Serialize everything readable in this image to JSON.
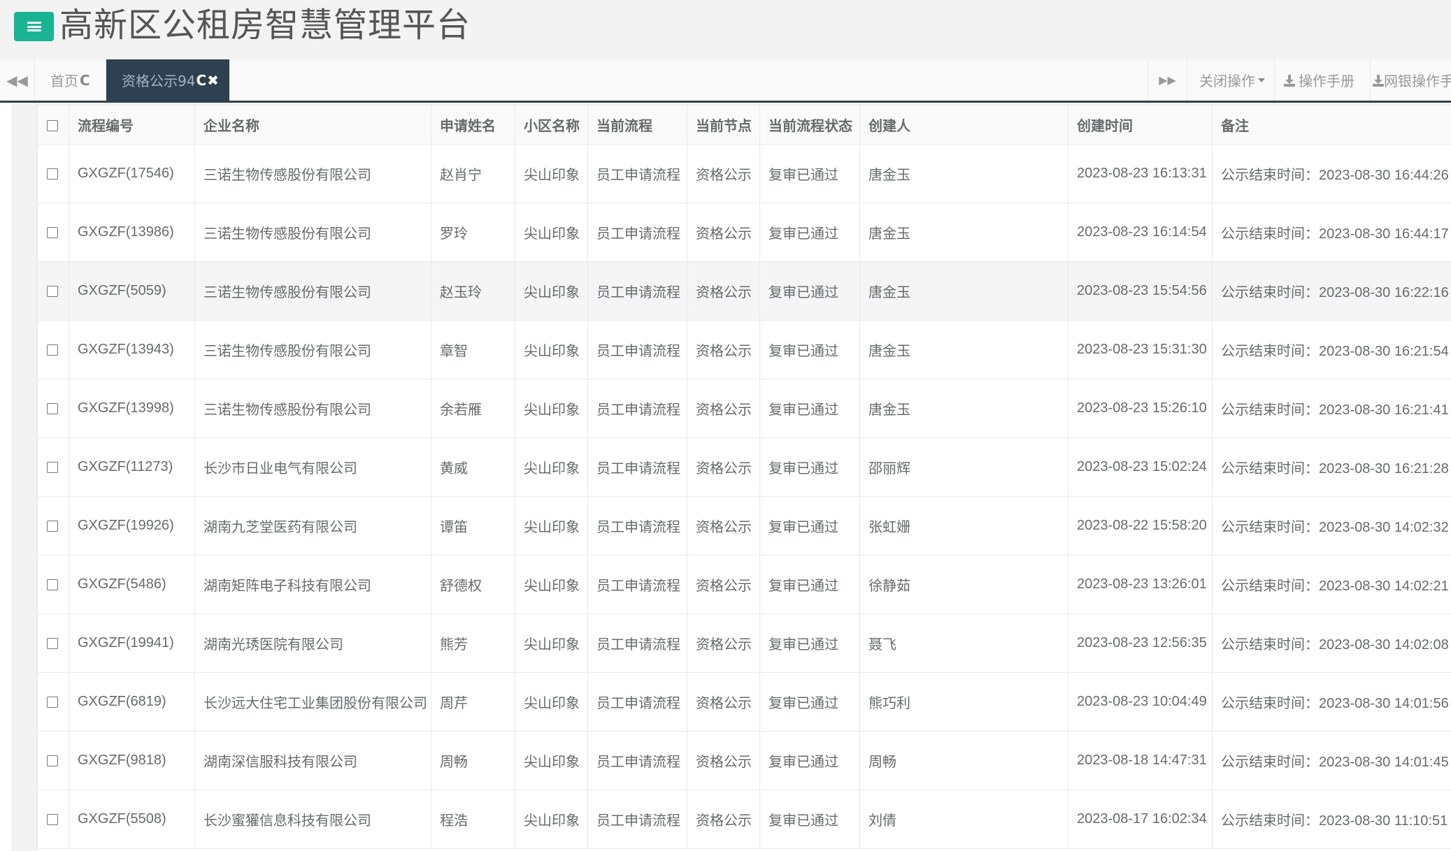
{
  "header": {
    "title": "高新区公租房智慧管理平台",
    "menu_icon": "hamburger-icon",
    "accent_color": "#1ab394"
  },
  "tabs": {
    "home": {
      "label": "首页",
      "icon": "reload-icon"
    },
    "active": {
      "label": "资格公示94",
      "icons": [
        "reload-icon",
        "close-icon"
      ]
    },
    "close_ops": "关闭操作",
    "manual": "操作手册",
    "ebank_manual": "网银操作手册"
  },
  "table": {
    "headers": [
      "流程编号",
      "企业名称",
      "申请姓名",
      "小区名称",
      "当前流程",
      "当前节点",
      "当前流程状态",
      "创建人",
      "创建时间",
      "备注"
    ],
    "rows": [
      [
        "GXGZF(17546)",
        "三诺生物传感股份有限公司",
        "赵肖宁",
        "尖山印象",
        "员工申请流程",
        "资格公示",
        "复审已通过",
        "唐金玉",
        "2023-08-23 16:13:31",
        "公示结束时间：2023-08-30 16:44:26"
      ],
      [
        "GXGZF(13986)",
        "三诺生物传感股份有限公司",
        "罗玲",
        "尖山印象",
        "员工申请流程",
        "资格公示",
        "复审已通过",
        "唐金玉",
        "2023-08-23 16:14:54",
        "公示结束时间：2023-08-30 16:44:17"
      ],
      [
        "GXGZF(5059)",
        "三诺生物传感股份有限公司",
        "赵玉玲",
        "尖山印象",
        "员工申请流程",
        "资格公示",
        "复审已通过",
        "唐金玉",
        "2023-08-23 15:54:56",
        "公示结束时间：2023-08-30 16:22:16"
      ],
      [
        "GXGZF(13943)",
        "三诺生物传感股份有限公司",
        "章智",
        "尖山印象",
        "员工申请流程",
        "资格公示",
        "复审已通过",
        "唐金玉",
        "2023-08-23 15:31:30",
        "公示结束时间：2023-08-30 16:21:54"
      ],
      [
        "GXGZF(13998)",
        "三诺生物传感股份有限公司",
        "余若雁",
        "尖山印象",
        "员工申请流程",
        "资格公示",
        "复审已通过",
        "唐金玉",
        "2023-08-23 15:26:10",
        "公示结束时间：2023-08-30 16:21:41"
      ],
      [
        "GXGZF(11273)",
        "长沙市日业电气有限公司",
        "黄威",
        "尖山印象",
        "员工申请流程",
        "资格公示",
        "复审已通过",
        "邵丽辉",
        "2023-08-23 15:02:24",
        "公示结束时间：2023-08-30 16:21:28"
      ],
      [
        "GXGZF(19926)",
        "湖南九芝堂医药有限公司",
        "谭笛",
        "尖山印象",
        "员工申请流程",
        "资格公示",
        "复审已通过",
        "张虹姗",
        "2023-08-22 15:58:20",
        "公示结束时间：2023-08-30 14:02:32"
      ],
      [
        "GXGZF(5486)",
        "湖南矩阵电子科技有限公司",
        "舒德权",
        "尖山印象",
        "员工申请流程",
        "资格公示",
        "复审已通过",
        "徐静茹",
        "2023-08-23 13:26:01",
        "公示结束时间：2023-08-30 14:02:21"
      ],
      [
        "GXGZF(19941)",
        "湖南光琇医院有限公司",
        "熊芳",
        "尖山印象",
        "员工申请流程",
        "资格公示",
        "复审已通过",
        "聂飞",
        "2023-08-23 12:56:35",
        "公示结束时间：2023-08-30 14:02:08"
      ],
      [
        "GXGZF(6819)",
        "长沙远大住宅工业集团股份有限公司",
        "周芹",
        "尖山印象",
        "员工申请流程",
        "资格公示",
        "复审已通过",
        "熊巧利",
        "2023-08-23 10:04:49",
        "公示结束时间：2023-08-30 14:01:56"
      ],
      [
        "GXGZF(9818)",
        "湖南深信服科技有限公司",
        "周畅",
        "尖山印象",
        "员工申请流程",
        "资格公示",
        "复审已通过",
        "周畅",
        "2023-08-18 14:47:31",
        "公示结束时间：2023-08-30 14:01:45"
      ],
      [
        "GXGZF(5508)",
        "长沙蜜獾信息科技有限公司",
        "程浩",
        "尖山印象",
        "员工申请流程",
        "资格公示",
        "复审已通过",
        "刘倩",
        "2023-08-17 16:02:34",
        "公示结束时间：2023-08-30 11:10:51"
      ]
    ]
  }
}
